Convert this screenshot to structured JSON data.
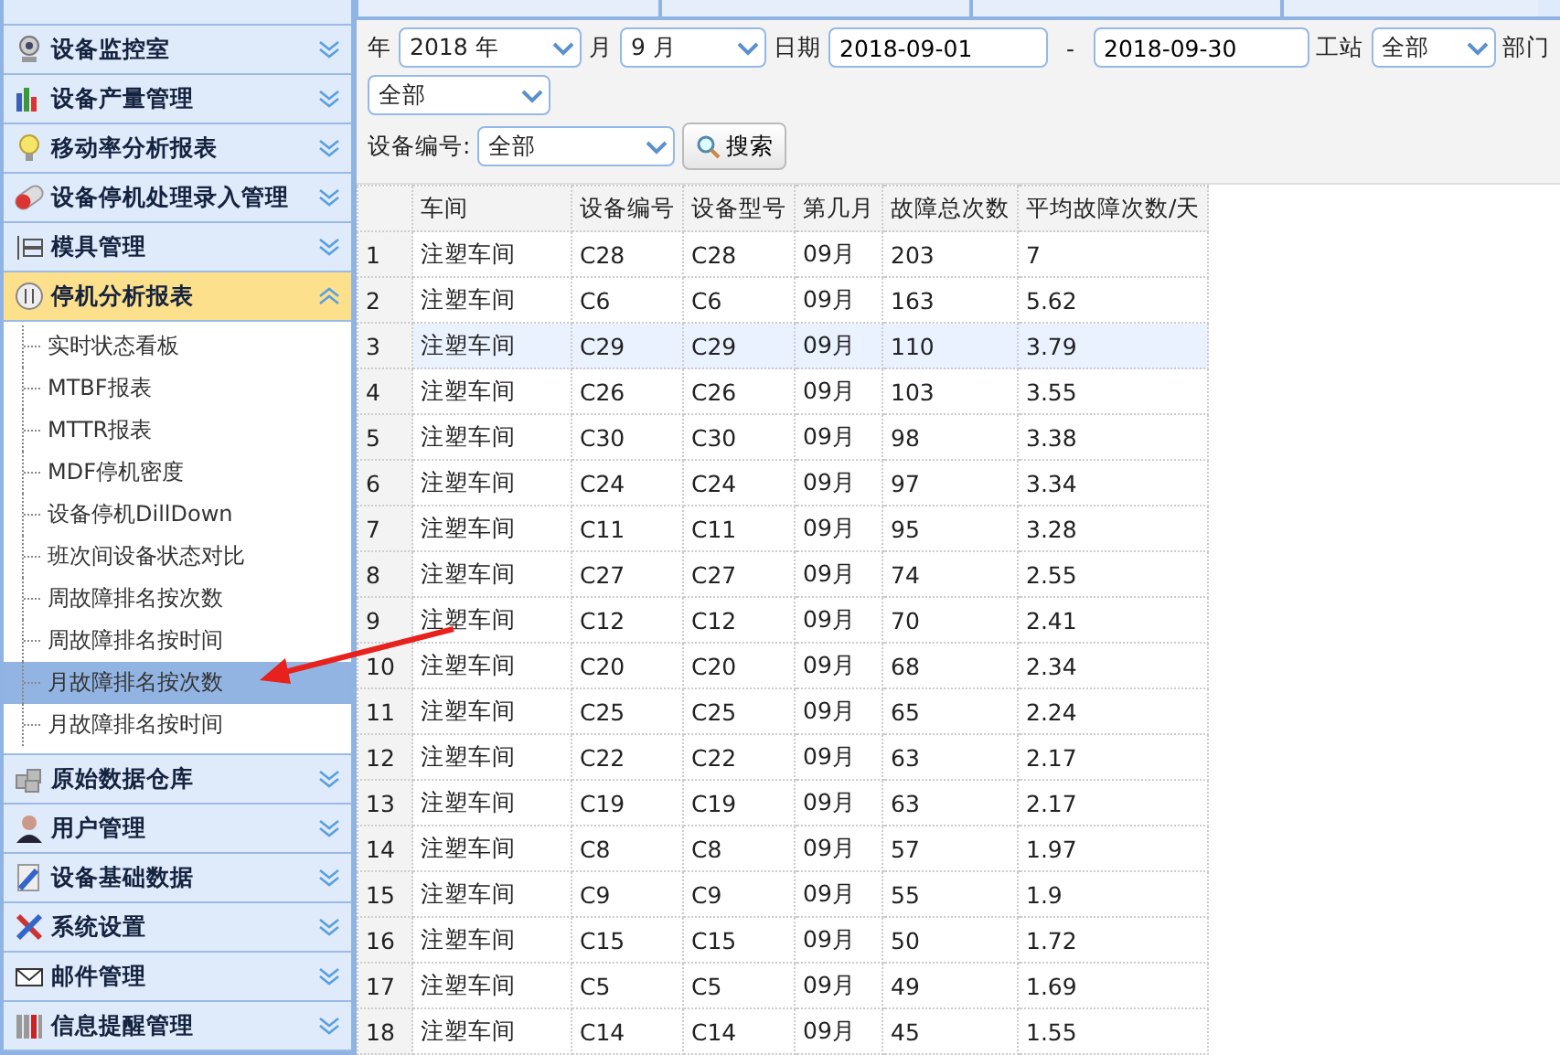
{
  "sidebar": {
    "groups": [
      {
        "label": "设备监控室",
        "expanded": false
      },
      {
        "label": "设备产量管理",
        "expanded": false
      },
      {
        "label": "移动率分析报表",
        "expanded": false
      },
      {
        "label": "设备停机处理录入管理",
        "expanded": false
      },
      {
        "label": "模具管理",
        "expanded": false
      },
      {
        "label": "停机分析报表",
        "expanded": true,
        "items": [
          {
            "label": "实时状态看板",
            "selected": false
          },
          {
            "label": "MTBF报表",
            "selected": false
          },
          {
            "label": "MTTR报表",
            "selected": false
          },
          {
            "label": "MDF停机密度",
            "selected": false
          },
          {
            "label": "设备停机DillDown",
            "selected": false
          },
          {
            "label": "班次间设备状态对比",
            "selected": false
          },
          {
            "label": "周故障排名按次数",
            "selected": false
          },
          {
            "label": "周故障排名按时间",
            "selected": false
          },
          {
            "label": "月故障排名按次数",
            "selected": true
          },
          {
            "label": "月故障排名按时间",
            "selected": false
          }
        ]
      },
      {
        "label": "原始数据仓库",
        "expanded": false
      },
      {
        "label": "用户管理",
        "expanded": false
      },
      {
        "label": "设备基础数据",
        "expanded": false
      },
      {
        "label": "系统设置",
        "expanded": false
      },
      {
        "label": "邮件管理",
        "expanded": false
      },
      {
        "label": "信息提醒管理",
        "expanded": false
      }
    ]
  },
  "filters": {
    "year_label": "年",
    "year": "2018 年",
    "month_label": "月",
    "month": "9 月",
    "date_label": "日期",
    "date_from": "2018-09-01",
    "date_sep": "-",
    "date_to": "2018-09-30",
    "station_label": "工站",
    "station": "全部",
    "dept_label": "部门",
    "dept": "全部",
    "device_label": "设备编号:",
    "device": "全部",
    "search_button": "搜索"
  },
  "table": {
    "columns": [
      "车间",
      "设备编号",
      "设备型号",
      "第几月",
      "故障总次数",
      "平均故障次数/天"
    ],
    "rows": [
      {
        "n": "1",
        "cells": [
          "注塑车间",
          "C28",
          "C28",
          "09月",
          "203",
          "7"
        ],
        "selected": false
      },
      {
        "n": "2",
        "cells": [
          "注塑车间",
          "C6",
          "C6",
          "09月",
          "163",
          "5.62"
        ],
        "selected": false
      },
      {
        "n": "3",
        "cells": [
          "注塑车间",
          "C29",
          "C29",
          "09月",
          "110",
          "3.79"
        ],
        "selected": true
      },
      {
        "n": "4",
        "cells": [
          "注塑车间",
          "C26",
          "C26",
          "09月",
          "103",
          "3.55"
        ],
        "selected": false
      },
      {
        "n": "5",
        "cells": [
          "注塑车间",
          "C30",
          "C30",
          "09月",
          "98",
          "3.38"
        ],
        "selected": false
      },
      {
        "n": "6",
        "cells": [
          "注塑车间",
          "C24",
          "C24",
          "09月",
          "97",
          "3.34"
        ],
        "selected": false
      },
      {
        "n": "7",
        "cells": [
          "注塑车间",
          "C11",
          "C11",
          "09月",
          "95",
          "3.28"
        ],
        "selected": false
      },
      {
        "n": "8",
        "cells": [
          "注塑车间",
          "C27",
          "C27",
          "09月",
          "74",
          "2.55"
        ],
        "selected": false
      },
      {
        "n": "9",
        "cells": [
          "注塑车间",
          "C12",
          "C12",
          "09月",
          "70",
          "2.41"
        ],
        "selected": false
      },
      {
        "n": "10",
        "cells": [
          "注塑车间",
          "C20",
          "C20",
          "09月",
          "68",
          "2.34"
        ],
        "selected": false
      },
      {
        "n": "11",
        "cells": [
          "注塑车间",
          "C25",
          "C25",
          "09月",
          "65",
          "2.24"
        ],
        "selected": false
      },
      {
        "n": "12",
        "cells": [
          "注塑车间",
          "C22",
          "C22",
          "09月",
          "63",
          "2.17"
        ],
        "selected": false
      },
      {
        "n": "13",
        "cells": [
          "注塑车间",
          "C19",
          "C19",
          "09月",
          "63",
          "2.17"
        ],
        "selected": false
      },
      {
        "n": "14",
        "cells": [
          "注塑车间",
          "C8",
          "C8",
          "09月",
          "57",
          "1.97"
        ],
        "selected": false
      },
      {
        "n": "15",
        "cells": [
          "注塑车间",
          "C9",
          "C9",
          "09月",
          "55",
          "1.9"
        ],
        "selected": false
      },
      {
        "n": "16",
        "cells": [
          "注塑车间",
          "C15",
          "C15",
          "09月",
          "50",
          "1.72"
        ],
        "selected": false
      },
      {
        "n": "17",
        "cells": [
          "注塑车间",
          "C5",
          "C5",
          "09月",
          "49",
          "1.69"
        ],
        "selected": false
      },
      {
        "n": "18",
        "cells": [
          "注塑车间",
          "C14",
          "C14",
          "09月",
          "45",
          "1.55"
        ],
        "selected": false
      }
    ]
  }
}
